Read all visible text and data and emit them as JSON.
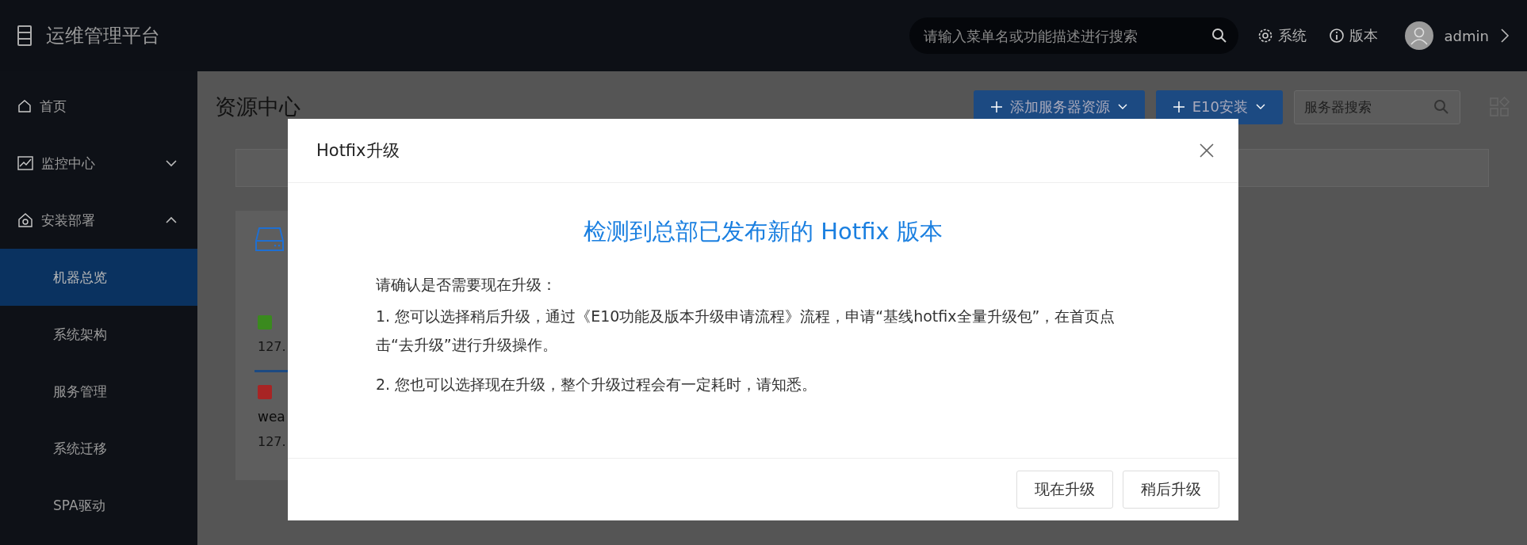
{
  "header": {
    "title": "运维管理平台",
    "search": {
      "placeholder": "请输入菜单名或功能描述进行搜索"
    },
    "links": [
      {
        "kind": "settings",
        "label": "系统"
      },
      {
        "kind": "info",
        "label": "版本"
      }
    ],
    "user": "admin"
  },
  "sidebar": {
    "items": [
      {
        "label": "首页",
        "kind": "home",
        "selected": false
      },
      {
        "label": "监控中心",
        "kind": "chart",
        "expanded": false
      },
      {
        "label": "安装部署",
        "kind": "deploy",
        "expanded": true,
        "children": [
          {
            "label": "机器总览",
            "selected": true
          },
          {
            "label": "系统架构",
            "selected": false
          },
          {
            "label": "服务管理",
            "selected": false
          },
          {
            "label": "系统迁移",
            "selected": false
          },
          {
            "label": "SPA驱动",
            "selected": false
          }
        ]
      }
    ]
  },
  "content": {
    "title": "资源中心",
    "buttons": [
      "添加服务器资源",
      "E10安装"
    ],
    "search": {
      "placeholder": "服务器搜索"
    },
    "servers": [
      {
        "ip": "127.",
        "color": "#3a8a1e"
      },
      {
        "name": "wea",
        "ip": "127.",
        "color": "#a82424"
      }
    ]
  },
  "dialog": {
    "title": "Hotfix升级",
    "heading": "检测到总部已发布新的 Hotfix 版本",
    "intro": "请确认是否需要现在升级：",
    "points": [
      "1. 您可以选择稍后升级，通过《E10功能及版本升级申请流程》流程，申请“基线hotfix全量升级包”，在首页点击“去升级”进行升级操作。",
      "2. 您也可以选择现在升级，整个升级过程会有一定耗时，请知悉。"
    ],
    "buttons": [
      "现在升级",
      "稍后升级"
    ]
  }
}
